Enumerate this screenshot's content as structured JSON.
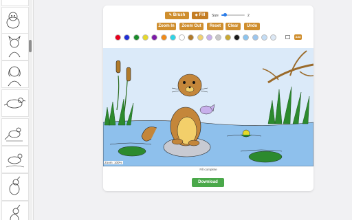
{
  "toolbar": {
    "brush_label": "Brush",
    "fill_label": "Fill",
    "size_label": "Size",
    "size_value": "2",
    "size_level": 0.15,
    "zoom_in_label": "Zoom In",
    "zoom_out_label": "Zoom Out",
    "reset_label": "Reset",
    "clear_label": "Clear",
    "undo_label": "Undo",
    "add_color_label": "Add",
    "brush_icon": "brush-icon",
    "fill_icon": "paint-bucket-icon"
  },
  "palette": [
    "#e8001c",
    "#1f2fd6",
    "#1a8c2a",
    "#e6d92a",
    "#7d1aa8",
    "#f08a18",
    "#2fd4e6",
    "#ffffff",
    "#b07a2a",
    "#f2d070",
    "#c8b0ec",
    "#c8c8c8",
    "#c9a832",
    "#1a1a1a",
    "#8cc4ee",
    "#9cc6ee",
    "#c4ddf5",
    "#dce8f5"
  ],
  "canvas": {
    "zoom_text": "Zoom: 100%",
    "status_text": "Fill complete"
  },
  "download_label": "Download",
  "colors": {
    "accent": "#cf8e2e",
    "download": "#4aa84a",
    "sky": "#dbeaf9",
    "water": "#8ec0ec",
    "otter": "#c4863a",
    "belly": "#f3cf6a",
    "rock": "#c8cad2"
  }
}
